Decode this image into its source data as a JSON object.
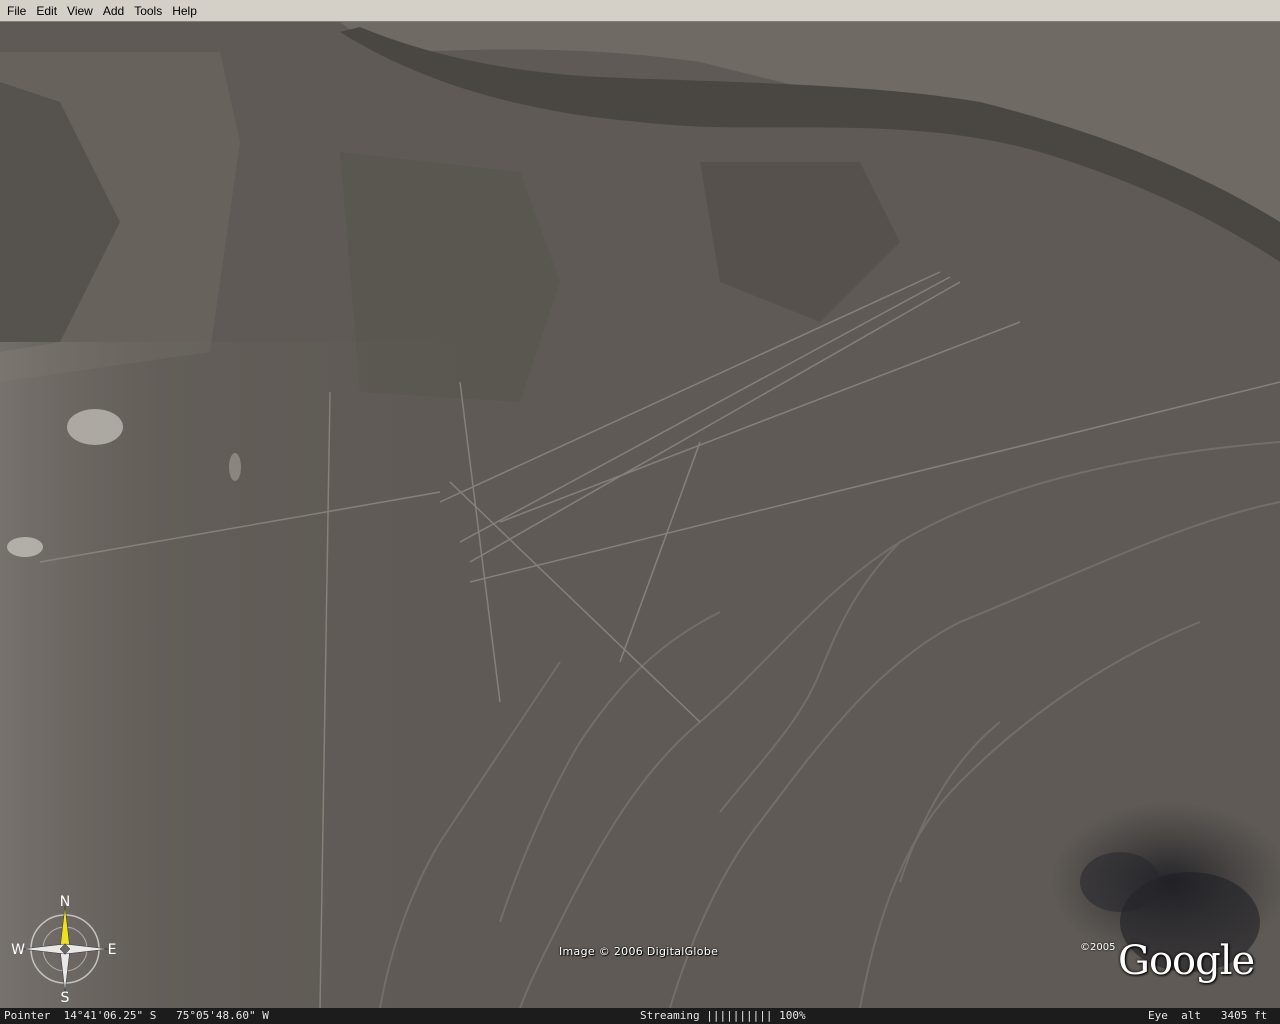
{
  "menubar": {
    "items": [
      {
        "label": "File"
      },
      {
        "label": "Edit"
      },
      {
        "label": "View"
      },
      {
        "label": "Add"
      },
      {
        "label": "Tools"
      },
      {
        "label": "Help"
      }
    ]
  },
  "viewport": {
    "imagery_credit": "Image © 2006 DigitalGlobe",
    "logo": {
      "copyright": "©2005",
      "text": "Google"
    },
    "compass": {
      "north": "N",
      "south": "S",
      "east": "E",
      "west": "W"
    }
  },
  "statusbar": {
    "pointer": "Pointer  14°41'06.25\" S   75°05'48.60\" W",
    "streaming": "Streaming |||||||||| 100%",
    "eye_alt": "Eye  alt   3405 ft"
  },
  "colors": {
    "menubar_bg": "#d4d0c8",
    "terrain_base": "#5f5a55",
    "statusbar_bg": "#1c1c1c",
    "compass_needle": "#f0e020"
  }
}
